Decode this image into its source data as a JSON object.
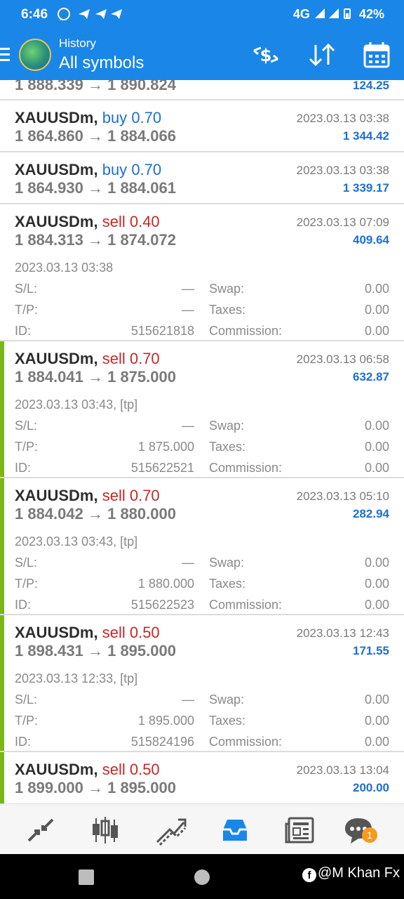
{
  "status_bar": {
    "time": "6:46",
    "network": "4G",
    "battery": "42%"
  },
  "header": {
    "title": "History",
    "subtitle": "All symbols"
  },
  "colors": {
    "header_bg": "#1a86e8",
    "buy": "#1c6fd4",
    "sell": "#c62828",
    "profit": "#1c6fd4",
    "tp_bar": "#7cb518",
    "badge": "#f59a1b"
  },
  "partial_row": {
    "prices": "1 888.339 → 1 890.824",
    "profit": "124.25"
  },
  "trades": [
    {
      "symbol": "XAUUSDm,",
      "side": "buy",
      "volume": "0.70",
      "prices": "1 864.860 → 1 884.066",
      "close_time": "2023.03.13 03:38",
      "profit": "1 344.42"
    },
    {
      "symbol": "XAUUSDm,",
      "side": "buy",
      "volume": "0.70",
      "prices": "1 864.930 → 1 884.061",
      "close_time": "2023.03.13 03:38",
      "profit": "1 339.17"
    },
    {
      "symbol": "XAUUSDm,",
      "side": "sell",
      "volume": "0.40",
      "prices": "1 884.313 → 1 874.072",
      "close_time": "2023.03.13 07:09",
      "profit": "409.64",
      "open_time": "2023.03.13 03:38",
      "sl": "—",
      "tp": "—",
      "id": "515621818",
      "swap": "0.00",
      "taxes": "0.00",
      "commission": "0.00"
    },
    {
      "symbol": "XAUUSDm,",
      "side": "sell",
      "volume": "0.70",
      "prices": "1 884.041 → 1 875.000",
      "close_time": "2023.03.13 06:58",
      "profit": "632.87",
      "open_time": "2023.03.13 03:43, [tp]",
      "sl": "—",
      "tp": "1 875.000",
      "id": "515622521",
      "swap": "0.00",
      "taxes": "0.00",
      "commission": "0.00"
    },
    {
      "symbol": "XAUUSDm,",
      "side": "sell",
      "volume": "0.70",
      "prices": "1 884.042 → 1 880.000",
      "close_time": "2023.03.13 05:10",
      "profit": "282.94",
      "open_time": "2023.03.13 03:43, [tp]",
      "sl": "—",
      "tp": "1 880.000",
      "id": "515622523",
      "swap": "0.00",
      "taxes": "0.00",
      "commission": "0.00"
    },
    {
      "symbol": "XAUUSDm,",
      "side": "sell",
      "volume": "0.50",
      "prices": "1 898.431 → 1 895.000",
      "close_time": "2023.03.13 12:43",
      "profit": "171.55",
      "open_time": "2023.03.13 12:33, [tp]",
      "sl": "—",
      "tp": "1 895.000",
      "id": "515824196",
      "swap": "0.00",
      "taxes": "0.00",
      "commission": "0.00"
    },
    {
      "symbol": "XAUUSDm,",
      "side": "sell",
      "volume": "0.50",
      "prices": "1 899.000 → 1 895.000",
      "close_time": "2023.03.13 13:04",
      "profit": "200.00"
    }
  ],
  "labels": {
    "sl": "S/L:",
    "tp": "T/P:",
    "id": "ID:",
    "swap": "Swap:",
    "taxes": "Taxes:",
    "commission": "Commission:"
  },
  "bottom_nav": {
    "items": [
      "quotes-icon",
      "chart-icon",
      "trade-icon",
      "history-icon",
      "news-icon",
      "messages-icon"
    ],
    "badge": "1"
  },
  "watermark": {
    "fb": "f",
    "text": "@M Khan Fx"
  }
}
